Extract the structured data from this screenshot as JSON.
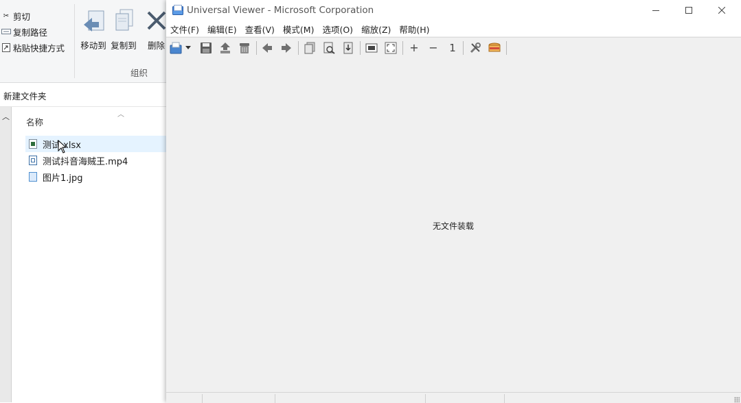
{
  "explorer": {
    "ribbon": {
      "cut_label": "剪切",
      "copy_path_label": "复制路径",
      "paste_shortcut_label": "粘贴快捷方式",
      "move_to_label": "移动到",
      "copy_to_label": "复制到",
      "delete_label": "删除",
      "group_label": "组织"
    },
    "address_text": "新建文件夹",
    "column_header": "名称",
    "files": [
      {
        "name": "测试.xlsx",
        "icon": "excel-file-icon",
        "selected": true
      },
      {
        "name": "测试抖音海贼王.mp4",
        "icon": "video-file-icon",
        "selected": false
      },
      {
        "name": "图片1.jpg",
        "icon": "image-file-icon",
        "selected": false
      }
    ]
  },
  "viewer": {
    "title": "Universal Viewer - Microsoft Corporation",
    "menu": [
      "文件(F)",
      "编辑(E)",
      "查看(V)",
      "模式(M)",
      "选项(O)",
      "缩放(Z)",
      "帮助(H)"
    ],
    "toolbar": {
      "zoom_in": "+",
      "zoom_out": "−",
      "actual_size": "1"
    },
    "empty_message": "无文件装载"
  },
  "colors": {
    "selection": "#e5f3ff",
    "viewer_bg": "#f0f0f0",
    "accent_blue": "#3a7bd5"
  }
}
